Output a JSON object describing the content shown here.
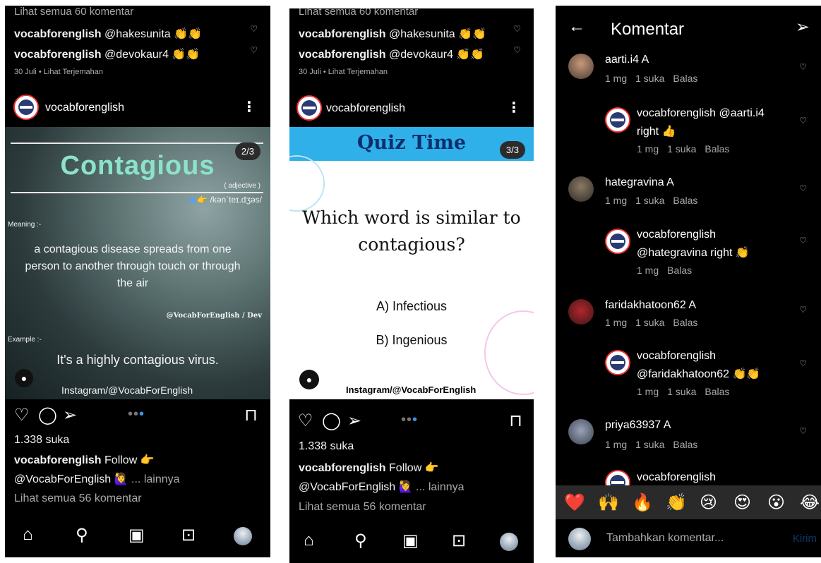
{
  "post1": {
    "top_comments_link": "Lihat semua 60 komentar",
    "comments": [
      {
        "user": "vocabforenglish",
        "text": " @hakesunita 👏👏"
      },
      {
        "user": "vocabforenglish",
        "text": " @devokaur4 👏👏"
      }
    ],
    "date": "30 Juli",
    "translate": "Lihat Terjemahan",
    "author": "vocabforenglish",
    "badge": "2/3",
    "word": "Contagious",
    "pos": "( adjective )",
    "pron": "/kənˈteɪ.dʒəs/",
    "meaning_label": "Meaning :-",
    "meaning": "a contagious disease spreads from one person to another through touch or through the air",
    "credit": "@VocabForEnglish / Dev",
    "example_label": "Example :-",
    "example": "It's a highly contagious virus.",
    "insta": "Instagram/@VocabForEnglish",
    "likes": "1.338 suka",
    "caption_user": "vocabforenglish",
    "caption_text": " Follow 👉",
    "caption_line2": "@VocabForEnglish 🙋‍♀️",
    "more": "... lainnya",
    "all_comments": "Lihat semua 56 komentar"
  },
  "post2": {
    "top_comments_link": "Lihat semua 60 komentar",
    "comments": [
      {
        "user": "vocabforenglish",
        "text": " @hakesunita 👏👏"
      },
      {
        "user": "vocabforenglish",
        "text": " @devokaur4 👏👏"
      }
    ],
    "date": "30 Juli",
    "translate": "Lihat Terjemahan",
    "author": "vocabforenglish",
    "banner": "Quiz Time",
    "badge": "3/3",
    "question": "Which word is similar to contagious?",
    "options": [
      "A) Infectious",
      "B) Ingenious"
    ],
    "insta": "Instagram/@VocabForEnglish",
    "likes": "1.338 suka",
    "caption_user": "vocabforenglish",
    "caption_text": " Follow 👉",
    "caption_line2": "@VocabForEnglish 🙋‍♀️",
    "more": "... lainnya",
    "all_comments": "Lihat semua 56 komentar"
  },
  "comments_panel": {
    "title": "Komentar",
    "items": [
      {
        "name": "aarti.i4 A",
        "meta": [
          "1 mg",
          "1 suka",
          "Balas"
        ]
      },
      {
        "name": "vocabforenglish @aarti.i4",
        "text": "right 👍",
        "meta": [
          "1 mg",
          "1 suka",
          "Balas"
        ]
      },
      {
        "name": "hategravina A",
        "meta": [
          "1 mg",
          "1 suka",
          "Balas"
        ]
      },
      {
        "name": "vocabforenglish",
        "text": "@hategravina right 👏",
        "meta": [
          "1 mg",
          "Balas"
        ]
      },
      {
        "name": "faridakhatoon62 A",
        "meta": [
          "1 mg",
          "1 suka",
          "Balas"
        ]
      },
      {
        "name": "vocabforenglish",
        "text": "@faridakhatoon62 👏👏",
        "meta": [
          "1 mg",
          "1 suka",
          "Balas"
        ]
      },
      {
        "name": "priya63937 A",
        "meta": [
          "1 mg",
          "1 suka",
          "Balas"
        ]
      },
      {
        "name": "vocabforenglish"
      }
    ],
    "emojis": [
      "❤️",
      "🙌",
      "🔥",
      "👏",
      "😢",
      "😍",
      "😮",
      "😂"
    ],
    "input_placeholder": "Tambahkan komentar...",
    "send_label": "Kirim"
  },
  "colors": {
    "accent_blue": "#2fb0e8",
    "word_green": "#8be3c9",
    "background": "#000000"
  }
}
